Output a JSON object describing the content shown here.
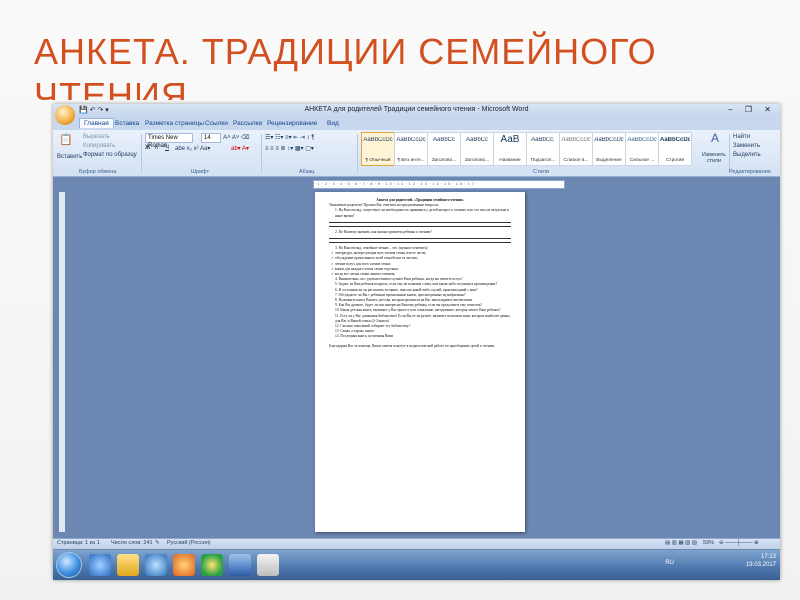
{
  "slide": {
    "title_line1": "АНКЕТА. ТРАДИЦИИ СЕМЕЙНОГО",
    "title_line2": "ЧТЕНИЯ"
  },
  "window": {
    "title": "АНКЕТА для родителей Традиции семейного чтения - Microsoft Word"
  },
  "tabs": [
    "Главная",
    "Вставка",
    "Разметка страницы",
    "Ссылки",
    "Рассылки",
    "Рецензирование",
    "Вид"
  ],
  "ribbon": {
    "paste_label": "Вставить",
    "cut_label": "Вырезать",
    "copy_label": "Копировать",
    "format_painter_label": "Формат по образцу",
    "font_name": "Times New Roman",
    "font_size": "14",
    "find_label": "Найти",
    "replace_label": "Заменить",
    "select_label": "Выделить",
    "change_styles_label": "Изменить стили",
    "groups": {
      "clipboard": "Буфер обмена",
      "font": "Шрифт",
      "paragraph": "Абзац",
      "styles": "Стили",
      "editing": "Редактирование"
    },
    "styles": [
      {
        "sample": "AaBbCcDc",
        "name": "¶ Обычный"
      },
      {
        "sample": "AaBbCcDc",
        "name": "¶ Без инте..."
      },
      {
        "sample": "AaBbCc",
        "name": "Заголово..."
      },
      {
        "sample": "AaBbCc",
        "name": "Заголово..."
      },
      {
        "sample": "AaB",
        "name": "Название"
      },
      {
        "sample": "AaBbCc.",
        "name": "Подзагол..."
      },
      {
        "sample": "AaBbCcDc",
        "name": "Слабое в..."
      },
      {
        "sample": "AaBbCcDc",
        "name": "Выделение"
      },
      {
        "sample": "AaBbCcDc",
        "name": "Сильное ..."
      },
      {
        "sample": "AaBbCcDc",
        "name": "Строгий"
      }
    ]
  },
  "document": {
    "heading": "Анкета для родителей. «Традиции семейного чтения»",
    "intro": "Уважаемые родители! Просим Вас ответить на предложенные вопросы.",
    "q1": "1. На Ваш взгляд, существует ли необходимость прививать у детей интерес к чтению, или эта тяга не актуальна в наше время?",
    "q2": "2. По Вашему мнению, как можно привлечь ребенка к чтению?",
    "q3": "3. На Ваш взгляд, семейное чтение – это: (нужное отметить)",
    "options": [
      "литература, интересующая всех членов семьи или ее части;",
      "обсуждение прочитанного всей семьей или ее частью;",
      "чтение вслух для всех членов семьи;",
      "книги для каждого члена семьи отдельно;",
      "когда все члены семьи заняты чтением;"
    ],
    "questions": [
      "4. Внимательно ли с удовольствием слушает Ваш ребенок, когда вы читаете вслух?",
      "5. Задает ли Вам ребенок вопросы, если ему не понятны слова, или какая-либо ситуация в произведении?",
      "6. В состоянии ли он рассказать историю, описать какой-либо случай, произошедший с ним?",
      "7. Обсуждаете ли Вы с ребенком прочитанные книги, просмотренные мультфильмы?",
      "8. Вспомните книгу Вашего детства, которая произвела на Вас неизгладимое впечатление",
      "9. Как Вы думаете, будет ли она интересна Вашему ребенку, если вы предложите ему почитать?",
      "10. Какая детская книга, вызывает у Вас протест или сожаление, негодование, которая читает Ваш ребенок?",
      "11. Есть ли у Вас домашняя библиотека? Если Вы ее загрузите, назовите несколько книг, которые наиболее ценны для Вас и Вашей семьи (2-3 книги)",
      "12. Сколько поколений собирает эту библиотеку?",
      "13. Самая «старая» книга",
      "14. Последняя книга, купленная Вами"
    ],
    "closing": "Благодарим Вас за помощь. Ваши ответы помогут в педагогической работе по приобщению детей к чтению."
  },
  "status": {
    "page": "Страница: 1 из 1",
    "words": "Число слов: 241",
    "language": "Русский (Россия)",
    "zoom": "59%"
  },
  "taskbar": {
    "lang": "RU",
    "time": "17:13",
    "date": "19.03.2017"
  }
}
